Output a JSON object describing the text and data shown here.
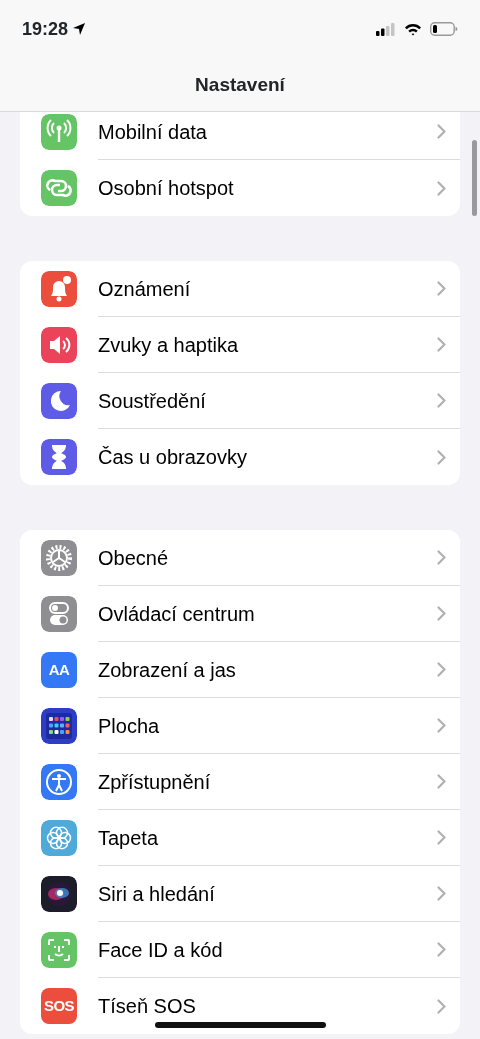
{
  "status_bar": {
    "time": "19:28"
  },
  "title": "Nastavení",
  "groups": [
    {
      "items": [
        {
          "label": "Mobilní data",
          "color": "#65c466"
        },
        {
          "label": "Osobní hotspot",
          "color": "#65c466"
        }
      ]
    },
    {
      "items": [
        {
          "label": "Oznámení",
          "color": "#eb4e3d"
        },
        {
          "label": "Zvuky a haptika",
          "color": "#eb445a"
        },
        {
          "label": "Soustředění",
          "color": "#5e5ce6"
        },
        {
          "label": "Čas u obrazovky",
          "color": "#5e5ce6"
        }
      ]
    },
    {
      "items": [
        {
          "label": "Obecné",
          "color": "#8e8e93"
        },
        {
          "label": "Ovládací centrum",
          "color": "#8e8e93"
        },
        {
          "label": "Zobrazení a jas",
          "color": "#3478f6",
          "icon_label": "AA"
        },
        {
          "label": "Plocha",
          "color": "#2c3fc4"
        },
        {
          "label": "Zpřístupnění",
          "color": "#3478f6"
        },
        {
          "label": "Tapeta",
          "color": "#4fa9d9"
        },
        {
          "label": "Siri a hledání",
          "color": "#1c1c2a"
        },
        {
          "label": "Face ID a kód",
          "color": "#65c466"
        },
        {
          "label": "Tíseň SOS",
          "color": "#eb4e3d",
          "icon_label": "SOS"
        }
      ]
    }
  ]
}
